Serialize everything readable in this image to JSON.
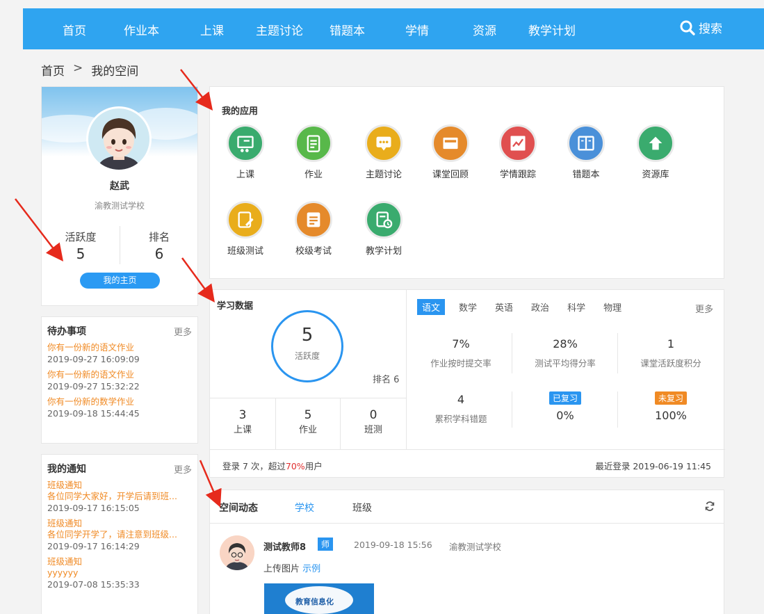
{
  "nav": {
    "items": [
      "首页",
      "作业本",
      "上课",
      "主题讨论",
      "错题本",
      "学情",
      "资源",
      "教学计划"
    ],
    "search_label": "搜索"
  },
  "breadcrumb": {
    "home": "首页",
    "sep": ">",
    "current": "我的空间"
  },
  "profile": {
    "name": "赵武",
    "school": "渝教测试学校",
    "activity_label": "活跃度",
    "activity_value": "5",
    "rank_label": "排名",
    "rank_value": "6",
    "home_button": "我的主页"
  },
  "todo": {
    "title": "待办事项",
    "more": "更多",
    "items": [
      {
        "text": "你有一份新的语文作业",
        "time": "2019-09-27 16:09:09"
      },
      {
        "text": "你有一份新的语文作业",
        "time": "2019-09-27 15:32:22"
      },
      {
        "text": "你有一份新的数学作业",
        "time": "2019-09-18 15:44:45"
      }
    ]
  },
  "notices": {
    "title": "我的通知",
    "more": "更多",
    "items": [
      {
        "type": "班级通知",
        "text": "各位同学大家好，开学后请到班...",
        "time": "2019-09-17 16:15:05"
      },
      {
        "type": "班级通知",
        "text": "各位同学开学了，请注意到班级...",
        "time": "2019-09-17 16:14:29"
      },
      {
        "type": "班级通知",
        "text": "yyyyyy",
        "time": "2019-07-08 15:35:33"
      }
    ]
  },
  "apps": {
    "title": "我的应用",
    "items": [
      {
        "label": "上课",
        "color": "#3aab6e",
        "icon": "teaching-icon"
      },
      {
        "label": "作业",
        "color": "#58b84a",
        "icon": "homework-icon"
      },
      {
        "label": "主题讨论",
        "color": "#e9ad1c",
        "icon": "discussion-icon"
      },
      {
        "label": "课堂回顾",
        "color": "#e58a2b",
        "icon": "review-icon"
      },
      {
        "label": "学情跟踪",
        "color": "#e05050",
        "icon": "tracking-icon"
      },
      {
        "label": "错题本",
        "color": "#4a90d9",
        "icon": "mistake-book-icon"
      },
      {
        "label": "资源库",
        "color": "#3aab6e",
        "icon": "resource-icon"
      },
      {
        "label": "班级测试",
        "color": "#e9ad1c",
        "icon": "class-test-icon"
      },
      {
        "label": "校级考试",
        "color": "#e58a2b",
        "icon": "school-exam-icon"
      },
      {
        "label": "教学计划",
        "color": "#3aab6e",
        "icon": "plan-icon"
      }
    ]
  },
  "study": {
    "title": "学习数据",
    "activity_value": "5",
    "activity_label": "活跃度",
    "rank_text": "排名 6",
    "counts": [
      {
        "value": "3",
        "label": "上课"
      },
      {
        "value": "5",
        "label": "作业"
      },
      {
        "value": "0",
        "label": "班测"
      }
    ],
    "subjects": [
      "语文",
      "数学",
      "英语",
      "政治",
      "科学",
      "物理"
    ],
    "active_subject": "语文",
    "subjects_more": "更多",
    "metrics": [
      {
        "value": "7%",
        "label": "作业按时提交率"
      },
      {
        "value": "28%",
        "label": "测试平均得分率"
      },
      {
        "value": "1",
        "label": "课堂活跃度积分"
      },
      {
        "value": "4",
        "label": "累积学科错题"
      }
    ],
    "reviewed_tag": "已复习",
    "reviewed_value": "0%",
    "unreviewed_tag": "未复习",
    "unreviewed_value": "100%",
    "login_prefix": "登录 7 次，超过",
    "login_percent": "70%",
    "login_suffix": "用户",
    "last_login": "最近登录 2019-06-19 11:45"
  },
  "feed": {
    "title": "空间动态",
    "tab_school": "学校",
    "tab_class": "班级",
    "post": {
      "author": "测试教师8",
      "role": "师",
      "time": "2019-09-18 15:56",
      "school": "渝教测试学校",
      "text": "上传图片",
      "link": "示例",
      "image_caption": "教育信息化"
    }
  },
  "colors": {
    "nav_bg": "#2fa4f0",
    "accent": "#2a95f0",
    "todo_link": "#f08a24",
    "reviewed_tag": "#2a95f0",
    "unreviewed_tag": "#f08a24",
    "annotation_arrow": "#e62a1c"
  }
}
